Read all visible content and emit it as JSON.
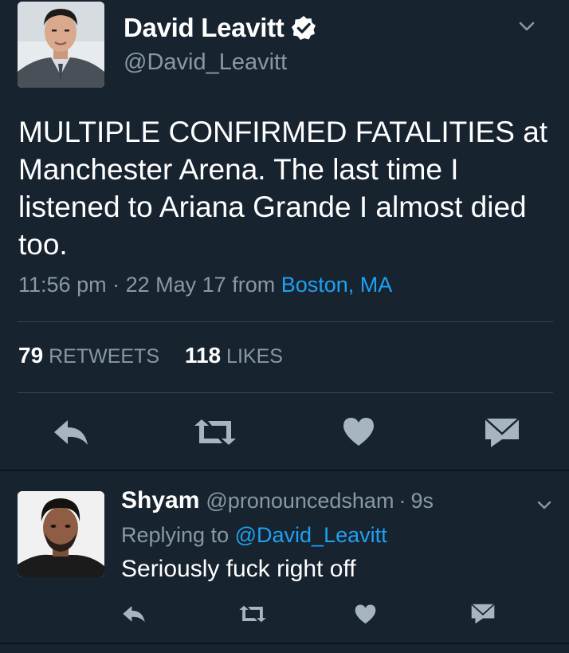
{
  "tweet": {
    "author_name": "David Leavitt",
    "author_handle": "@David_Leavitt",
    "verified": true,
    "text": "MULTIPLE CONFIRMED FATALITIES at Manchester Arena. The last time I listened to Ariana Grande I almost died too.",
    "time": "11:56 pm",
    "separator": "·",
    "date": "22 May 17",
    "from_label": "from",
    "location": "Boston, MA",
    "retweets_count": "79",
    "retweets_label": "RETWEETS",
    "likes_count": "118",
    "likes_label": "LIKES",
    "actions": [
      "reply-icon",
      "retweet-icon",
      "like-icon",
      "direct-message-icon"
    ]
  },
  "reply": {
    "author_name": "Shyam",
    "author_handle": "@pronouncedsham",
    "separator": "·",
    "time": "9s",
    "replying_to_label": "Replying to",
    "replying_to_handle": "@David_Leavitt",
    "text": "Seriously fuck right off",
    "actions": [
      "reply-icon",
      "retweet-icon",
      "like-icon",
      "direct-message-icon"
    ]
  },
  "colors": {
    "background": "#182330",
    "primary_text": "#ffffff",
    "secondary_text": "#8899a6",
    "link": "#1da1f2",
    "divider": "#38444d",
    "icon": "#a7b5c1"
  }
}
